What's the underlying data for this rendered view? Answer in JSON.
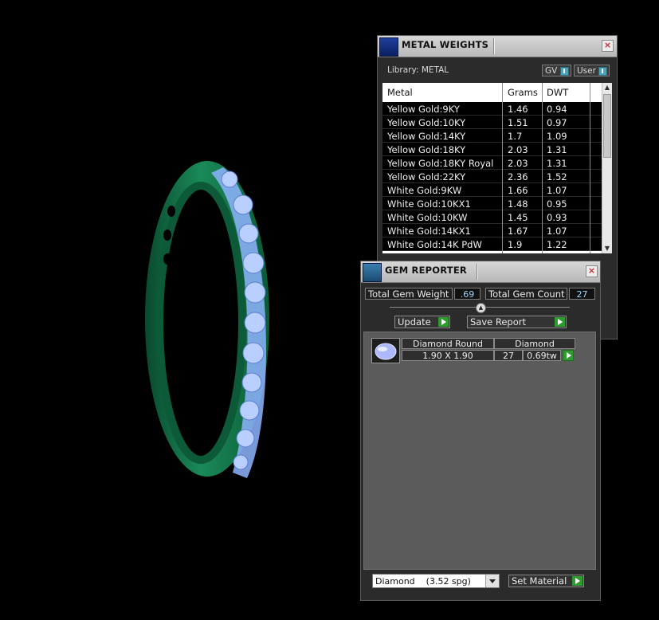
{
  "metal_weights": {
    "title": "METAL WEIGHTS",
    "library_label": "Library: METAL",
    "toggles": [
      "GV",
      "User"
    ],
    "columns": [
      "Metal",
      "Grams",
      "DWT"
    ],
    "rows": [
      {
        "metal": "Yellow Gold:9KY",
        "grams": "1.46",
        "dwt": "0.94"
      },
      {
        "metal": "Yellow Gold:10KY",
        "grams": "1.51",
        "dwt": "0.97"
      },
      {
        "metal": "Yellow Gold:14KY",
        "grams": "1.7",
        "dwt": "1.09"
      },
      {
        "metal": "Yellow Gold:18KY",
        "grams": "2.03",
        "dwt": "1.31"
      },
      {
        "metal": "Yellow Gold:18KY Royal",
        "grams": "2.03",
        "dwt": "1.31"
      },
      {
        "metal": "Yellow Gold:22KY",
        "grams": "2.36",
        "dwt": "1.52"
      },
      {
        "metal": "White Gold:9KW",
        "grams": "1.66",
        "dwt": "1.07"
      },
      {
        "metal": "White Gold:10KX1",
        "grams": "1.48",
        "dwt": "0.95"
      },
      {
        "metal": "White Gold:10KW",
        "grams": "1.45",
        "dwt": "0.93"
      },
      {
        "metal": "White Gold:14KX1",
        "grams": "1.67",
        "dwt": "1.07"
      },
      {
        "metal": "White Gold:14K PdW",
        "grams": "1.9",
        "dwt": "1.22"
      }
    ]
  },
  "gem_reporter": {
    "title": "GEM REPORTER",
    "total_gem_weight_label": "Total Gem Weight",
    "total_gem_weight_value": ".69",
    "total_gem_count_label": "Total Gem Count",
    "total_gem_count_value": "27",
    "update_label": "Update",
    "save_report_label": "Save Report",
    "gem": {
      "shape": "Diamond Round",
      "size": "1.90 X 1.90",
      "material": "Diamond",
      "count": "27",
      "weight": "0.69tw"
    },
    "material_select": "Diamond    (3.52 spg)",
    "set_material_label": "Set Material"
  },
  "colors": {
    "panel_bg": "#2b2b2b",
    "ring_metal": "#0f6e45",
    "gem_blue": "#8fb4ff",
    "go_green": "#2e9c2e"
  }
}
